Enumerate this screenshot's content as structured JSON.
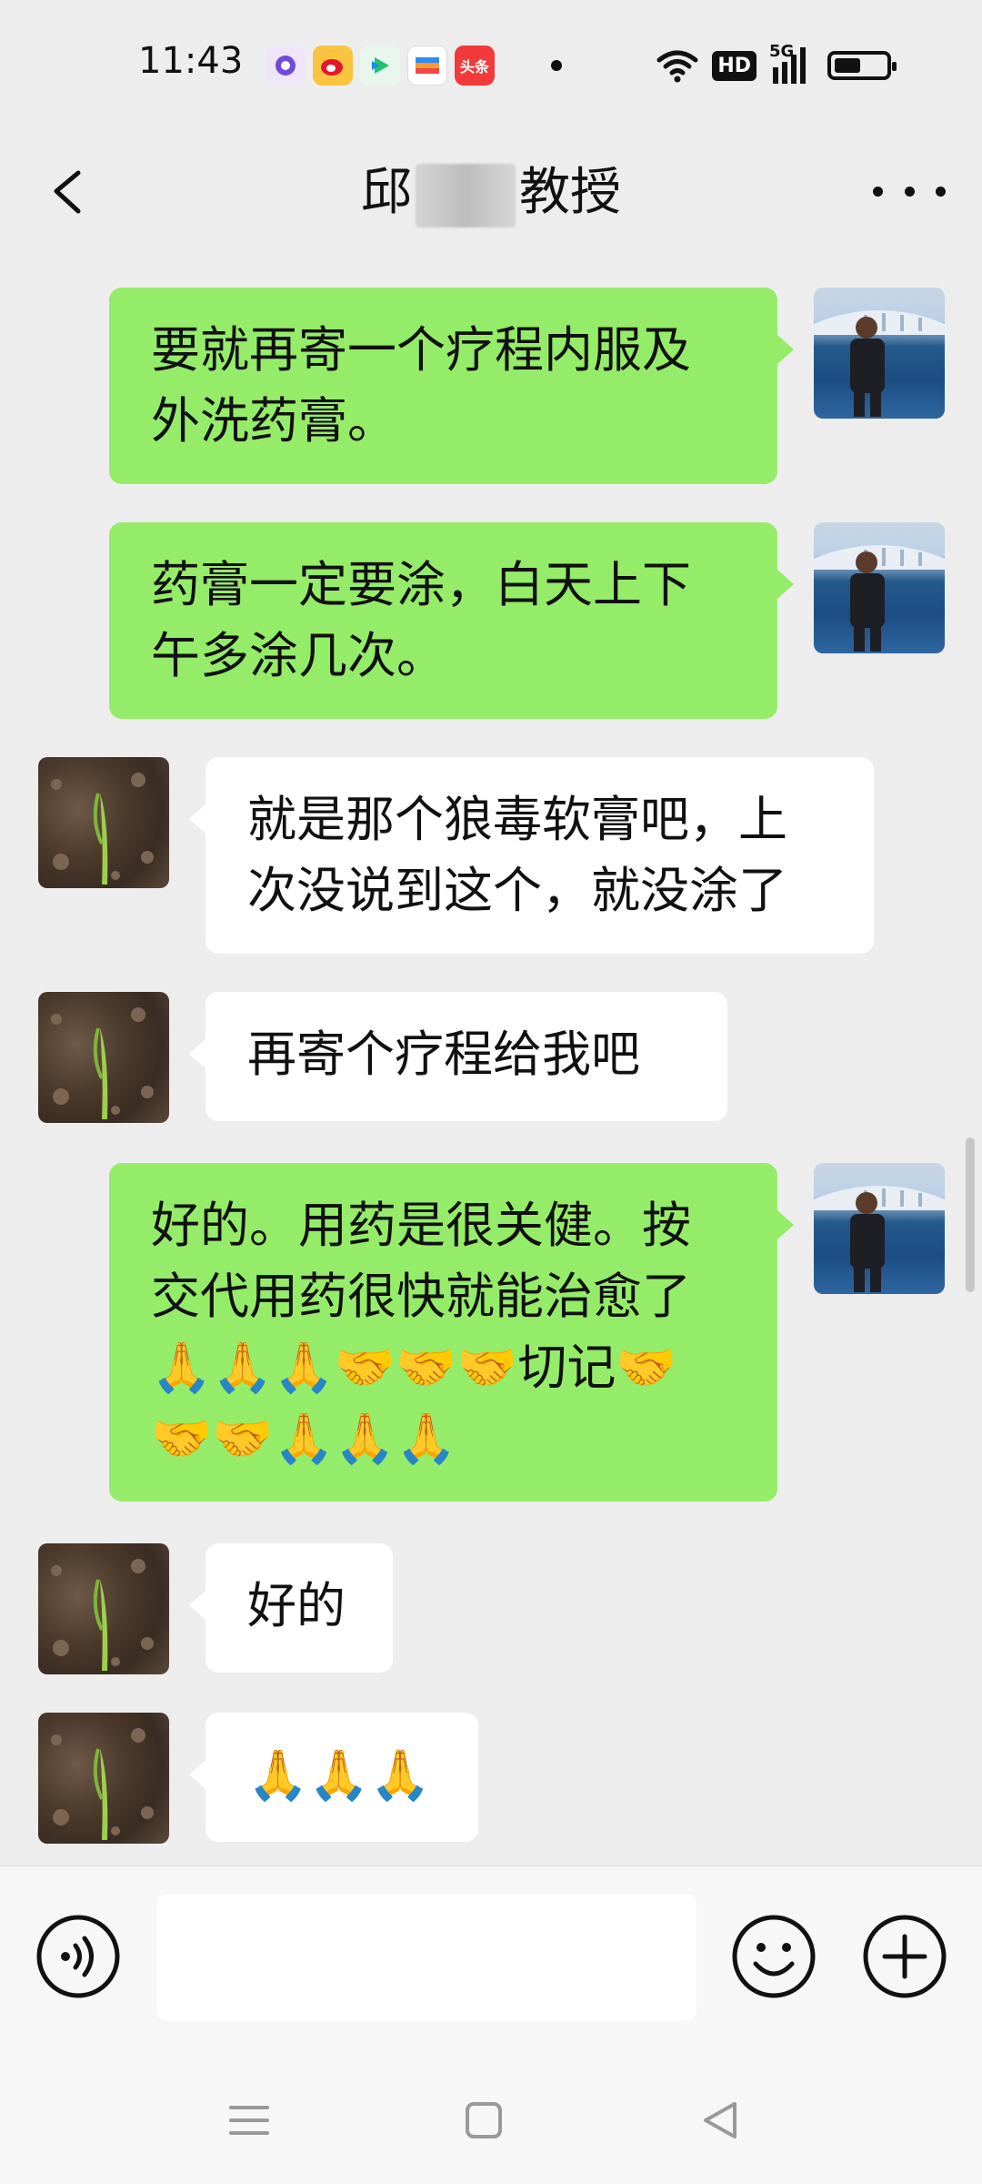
{
  "status_bar": {
    "time": "11:43",
    "network": "5G",
    "hd": "HD",
    "notification_icons": [
      "podcast-app-icon",
      "weibo-icon",
      "video-app-icon",
      "wallet-app-icon",
      "toutiao-icon"
    ],
    "toutiao_label": "头条"
  },
  "header": {
    "title_start": "邱",
    "title_end": "教授"
  },
  "messages": [
    {
      "direction": "out",
      "avatar": "lake-photo",
      "text": "要就再寄一个疗程内服及外洗药膏。"
    },
    {
      "direction": "out",
      "avatar": "lake-photo",
      "text": "药膏一定要涂，白天上下午多涂几次。"
    },
    {
      "direction": "in",
      "avatar": "sprout-photo",
      "text": "就是那个狼毒软膏吧，上次没说到这个，就没涂了"
    },
    {
      "direction": "in",
      "avatar": "sprout-photo",
      "text": "再寄个疗程给我吧"
    },
    {
      "direction": "out",
      "avatar": "lake-photo",
      "text": "好的。用药是很关健。按交代用药很快就能治愈了🙏🙏🙏🤝🤝🤝切记🤝🤝🤝🙏🙏🙏"
    },
    {
      "direction": "in",
      "avatar": "sprout-photo",
      "text": "好的"
    },
    {
      "direction": "in",
      "avatar": "sprout-photo",
      "text": "🙏🙏🙏"
    }
  ],
  "input": {
    "value": "",
    "placeholder": ""
  },
  "colors": {
    "outgoing_bubble": "#95ec69",
    "incoming_bubble": "#ffffff",
    "background": "#ededed"
  }
}
